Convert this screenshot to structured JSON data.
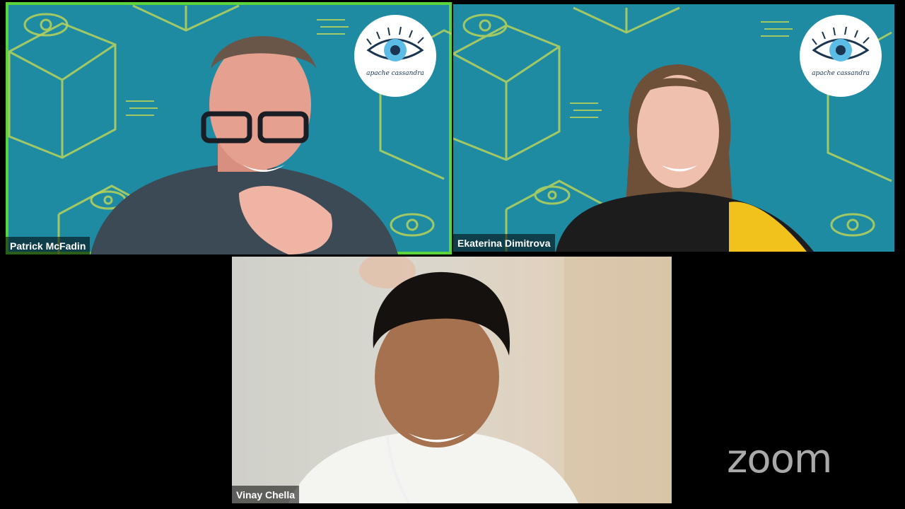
{
  "participants": [
    {
      "name": "Patrick McFadin",
      "active_speaker": true,
      "background": "apache-cassandra-virtual-background"
    },
    {
      "name": "Ekaterina Dimitrova",
      "active_speaker": false,
      "background": "apache-cassandra-virtual-background"
    },
    {
      "name": "Vinay Chella",
      "active_speaker": false,
      "background": "room"
    }
  ],
  "logo": {
    "text": "apache cassandra",
    "icon": "eye-icon"
  },
  "brand": {
    "wordmark": "zoom"
  },
  "colors": {
    "active_speaker_border": "#5cd23b",
    "virtual_background": "#1f8ba3",
    "pattern_lines": "#b8d35a",
    "wordmark": "#a9a9a9"
  }
}
